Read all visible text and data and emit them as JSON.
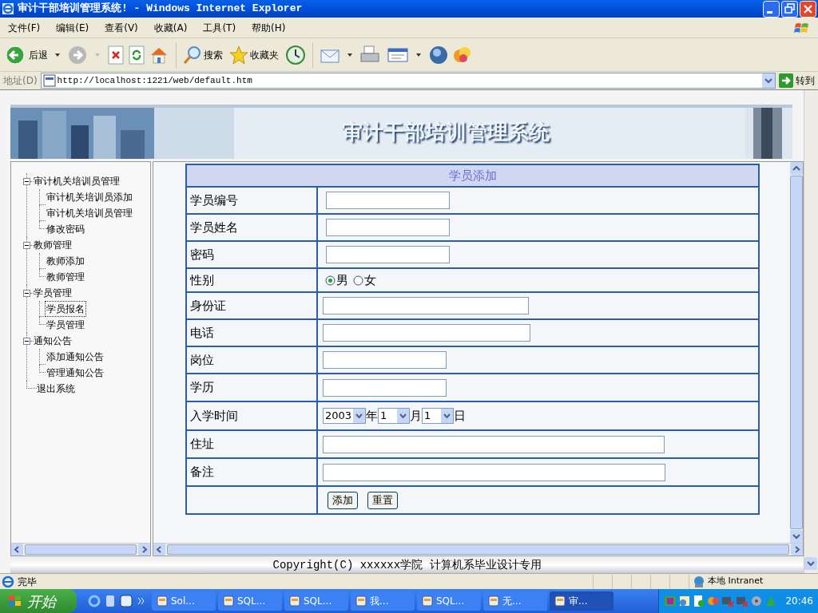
{
  "window": {
    "title": "审计干部培训管理系统! - Windows Internet Explorer"
  },
  "menu": [
    "文件(F)",
    "编辑(E)",
    "查看(V)",
    "收藏(A)",
    "工具(T)",
    "帮助(H)"
  ],
  "toolbar": {
    "back": "后退",
    "search": "搜索",
    "favorites": "收藏夹"
  },
  "address": {
    "label": "地址(D)",
    "url": "http://localhost:1221/web/default.htm",
    "go": "转到"
  },
  "banner": {
    "title": "审计干部培训管理系统"
  },
  "tree": [
    {
      "label": "审计机关培训员管理",
      "expanded": true,
      "children": [
        {
          "label": "审计机关培训员添加",
          "selected": false
        },
        {
          "label": "审计机关培训员管理",
          "selected": false
        },
        {
          "label": "修改密码",
          "selected": false
        }
      ]
    },
    {
      "label": "教师管理",
      "expanded": true,
      "children": [
        {
          "label": "教师添加",
          "selected": false
        },
        {
          "label": "教师管理",
          "selected": false
        }
      ]
    },
    {
      "label": "学员管理",
      "expanded": true,
      "children": [
        {
          "label": "学员报名",
          "selected": true
        },
        {
          "label": "学员管理",
          "selected": false
        }
      ]
    },
    {
      "label": "通知公告",
      "expanded": true,
      "children": [
        {
          "label": "添加通知公告",
          "selected": false
        },
        {
          "label": "管理通知公告",
          "selected": false
        }
      ]
    },
    {
      "label": "退出系统"
    }
  ],
  "form": {
    "title": "学员添加",
    "rows": [
      {
        "label": "学员编号",
        "kind": "text"
      },
      {
        "label": "学员姓名",
        "kind": "text"
      },
      {
        "label": "密码",
        "kind": "text"
      },
      {
        "label": "性别",
        "kind": "radio",
        "options": [
          {
            "label": "男",
            "selected": true
          },
          {
            "label": "女",
            "selected": false
          }
        ]
      },
      {
        "label": "身份证",
        "kind": "text"
      },
      {
        "label": "电话",
        "kind": "text"
      },
      {
        "label": "岗位",
        "kind": "text"
      },
      {
        "label": "学历",
        "kind": "text"
      },
      {
        "label": "入学时间",
        "kind": "date",
        "parts": [
          {
            "value": "2003",
            "unit": "年"
          },
          {
            "value": "1",
            "unit": "月"
          },
          {
            "value": "1",
            "unit": "日"
          }
        ]
      },
      {
        "label": "住址",
        "kind": "text"
      },
      {
        "label": "备注",
        "kind": "text"
      },
      {
        "kind": "buttons",
        "buttons": [
          "添加",
          "重置"
        ]
      }
    ]
  },
  "footer": "Copyright(C) xxxxxx学院 计算机系毕业设计专用",
  "status_bar": {
    "text": "完毕",
    "zone": "本地 Intranet"
  },
  "taskbar": {
    "start": "开始",
    "tasks": [
      {
        "label": "Sol...",
        "selected": false
      },
      {
        "label": "SQL...",
        "selected": false
      },
      {
        "label": "SQL...",
        "selected": false
      },
      {
        "label": "我...",
        "selected": false
      },
      {
        "label": "SQL...",
        "selected": false
      },
      {
        "label": "无...",
        "selected": false
      },
      {
        "label": "审...",
        "selected": true
      }
    ],
    "clock": "20:46"
  }
}
